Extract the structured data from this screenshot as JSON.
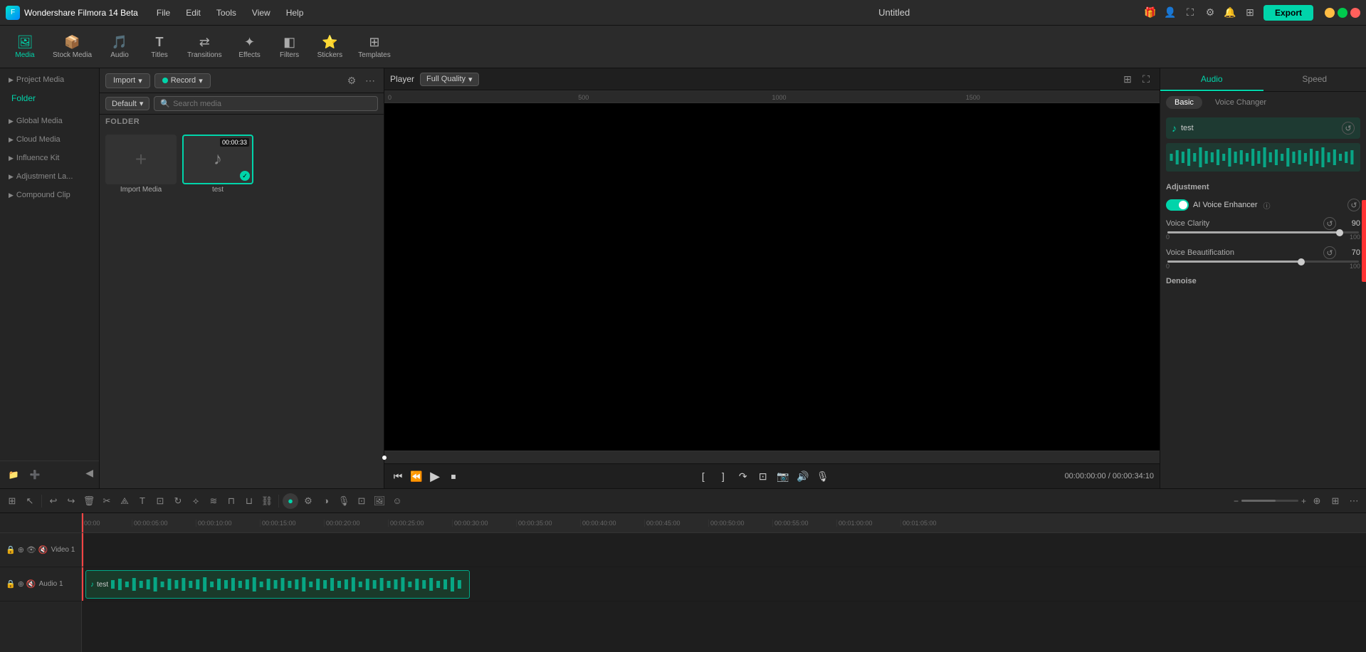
{
  "app": {
    "name": "Wondershare Filmora 14 Beta",
    "title": "Untitled",
    "logo_text": "F"
  },
  "menu": {
    "items": [
      "File",
      "Edit",
      "Tools",
      "View",
      "Help"
    ]
  },
  "export_btn": "Export",
  "toolbar": {
    "items": [
      {
        "id": "media",
        "icon": "🖼",
        "label": "Media",
        "active": true
      },
      {
        "id": "stock",
        "icon": "📦",
        "label": "Stock Media",
        "active": false
      },
      {
        "id": "audio",
        "icon": "🎵",
        "label": "Audio",
        "active": false
      },
      {
        "id": "titles",
        "icon": "T",
        "label": "Titles",
        "active": false
      },
      {
        "id": "transitions",
        "icon": "⟷",
        "label": "Transitions",
        "active": false
      },
      {
        "id": "effects",
        "icon": "✦",
        "label": "Effects",
        "active": false
      },
      {
        "id": "filters",
        "icon": "◧",
        "label": "Filters",
        "active": false
      },
      {
        "id": "stickers",
        "icon": "⭐",
        "label": "Stickers",
        "active": false
      },
      {
        "id": "templates",
        "icon": "⊞",
        "label": "Templates",
        "active": false
      }
    ]
  },
  "left_panel": {
    "sections": [
      {
        "id": "project-media",
        "label": "Project Media",
        "arrow": "▶"
      },
      {
        "id": "folder",
        "label": "Folder",
        "active": true
      },
      {
        "id": "global-media",
        "label": "Global Media",
        "arrow": "▶"
      },
      {
        "id": "cloud-media",
        "label": "Cloud Media",
        "arrow": "▶"
      },
      {
        "id": "influence-kit",
        "label": "Influence Kit",
        "arrow": "▶"
      },
      {
        "id": "adjustment-la",
        "label": "Adjustment La...",
        "arrow": "▶"
      },
      {
        "id": "compound-clip",
        "label": "Compound Clip",
        "arrow": "▶"
      }
    ]
  },
  "media_panel": {
    "import_label": "Import",
    "record_label": "Record",
    "default_label": "Default",
    "search_placeholder": "Search media",
    "folder_label": "FOLDER",
    "import_media_label": "Import Media",
    "test_file": {
      "name": "test",
      "duration": "00:00:33"
    }
  },
  "preview": {
    "label": "Player",
    "quality": "Full Quality",
    "time_current": "00:00:00:00",
    "time_total": "00:00:34:10"
  },
  "right_panel": {
    "tabs": [
      "Audio",
      "Speed"
    ],
    "active_tab": "Audio",
    "sub_tabs": [
      "Basic",
      "Voice Changer"
    ],
    "active_sub_tab": "Basic",
    "audio_file_name": "test",
    "adjustment_label": "Adjustment",
    "ai_voice_enhancer_label": "AI Voice Enhancer",
    "voice_clarity_label": "Voice Clarity",
    "voice_clarity_value": "90",
    "voice_clarity_min": "0",
    "voice_clarity_max": "100",
    "voice_clarity_percent": 90,
    "voice_beautification_label": "Voice Beautification",
    "voice_beautification_value": "70",
    "voice_beautification_min": "0",
    "voice_beautification_max": "100",
    "voice_beautification_percent": 70,
    "denoise_label": "Denoise"
  },
  "timeline": {
    "ruler_marks": [
      "00:00",
      "00:00:05:00",
      "00:00:10:00",
      "00:00:15:00",
      "00:00:20:00",
      "00:00:25:00",
      "00:00:30:00",
      "00:00:35:00",
      "00:00:40:00",
      "00:00:45:00",
      "00:00:50:00",
      "00:00:55:00",
      "00:01:00:00",
      "00:01:05:00"
    ],
    "tracks": [
      {
        "id": "video1",
        "label": "Video 1",
        "type": "video"
      },
      {
        "id": "audio1",
        "label": "Audio 1",
        "type": "audio",
        "clip_name": "test"
      }
    ]
  }
}
